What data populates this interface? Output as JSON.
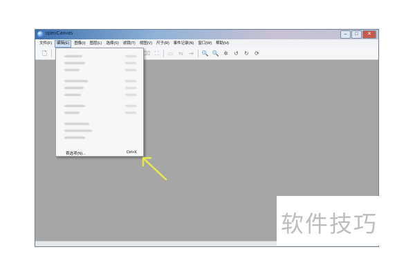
{
  "window": {
    "title": "openCanvas"
  },
  "window_controls": {
    "minimize": "–",
    "maximize": "□",
    "close": "✕"
  },
  "menubar": [
    {
      "label": "文件(F)"
    },
    {
      "label": "编辑(E)"
    },
    {
      "label": "图像(I)"
    },
    {
      "label": "图层(L)"
    },
    {
      "label": "选择(S)"
    },
    {
      "label": "滤镜(T)"
    },
    {
      "label": "视图(V)"
    },
    {
      "label": "尺子(R)"
    },
    {
      "label": "事件记录(N)"
    },
    {
      "label": "窗口(W)"
    },
    {
      "label": "帮助(H)"
    }
  ],
  "toolbar": [
    {
      "icon": "new-file-icon",
      "glyph": "🗋"
    },
    {
      "icon": "brush-icon",
      "glyph": "✎"
    },
    {
      "icon": "eraser-icon",
      "glyph": "⌫"
    },
    {
      "icon": "stamp-icon",
      "glyph": "⛶"
    },
    {
      "icon": "select-rect-icon",
      "glyph": "▭"
    },
    {
      "icon": "move-icon",
      "glyph": "⇆"
    },
    {
      "icon": "eyedropper-icon",
      "glyph": "⇥"
    },
    {
      "icon": "zoom-in-icon",
      "glyph": "🔍"
    },
    {
      "icon": "zoom-out-icon",
      "glyph": "🔍"
    },
    {
      "icon": "settings-icon",
      "glyph": "✲"
    },
    {
      "icon": "undo-icon",
      "glyph": "↺"
    },
    {
      "icon": "redo-icon",
      "glyph": "↻"
    },
    {
      "icon": "refresh-icon",
      "glyph": "⟳"
    }
  ],
  "edit_menu": {
    "preferences_label": "首选项(N)...",
    "preferences_shortcut": "Ctrl+K"
  },
  "watermark": {
    "text": "软件技巧"
  },
  "colors": {
    "canvas": "#a6a6a6",
    "arrow": "#e8e84a"
  }
}
